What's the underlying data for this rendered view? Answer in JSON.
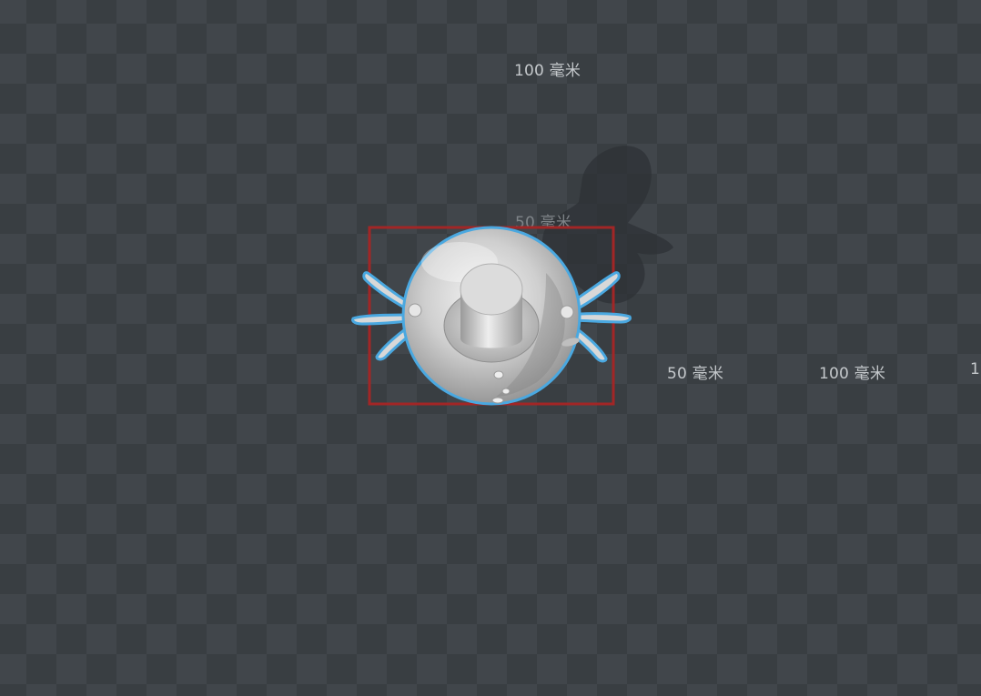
{
  "viewport": {
    "background": "checkerboard",
    "colors": {
      "checker_light": "#41464b",
      "checker_dark": "#393e42",
      "selection_box": "#a22626",
      "model_outline": "#4aa8e0",
      "model_fill": "#d9d9d9",
      "shadow": "#2b2f32"
    }
  },
  "rulers": {
    "top_100": "100 毫米",
    "top_50": "50 毫米",
    "right_50": "50 毫米",
    "right_100": "100 毫米",
    "right_edge": "1"
  },
  "model": {
    "icon": "snowman-top-hat-model",
    "selected": true
  }
}
